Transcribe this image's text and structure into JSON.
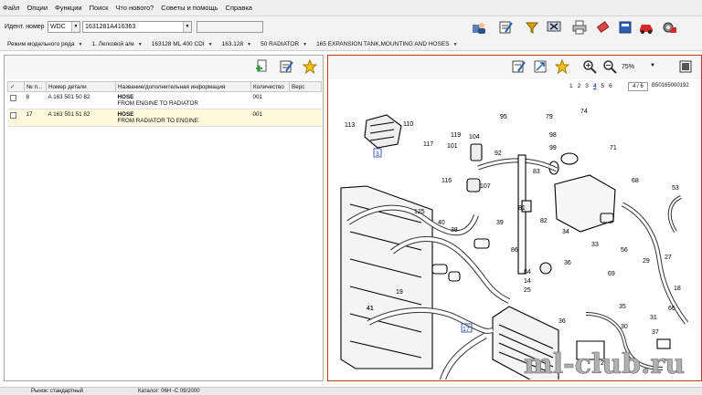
{
  "menu": [
    "Файл",
    "Опции",
    "Функции",
    "Поиск",
    "Что нового?",
    "Советы и помощь",
    "Справка"
  ],
  "ident": {
    "label": "Идент. номер",
    "type_value": "WDC",
    "vin_value": "1631281A416363",
    "extra_value": ""
  },
  "toolbar_icons": [
    "person-icon",
    "notepad-icon",
    "filter-icon",
    "screen-icon",
    "printer-icon",
    "eraser-icon",
    "book-icon",
    "car-icon",
    "gear-car-icon"
  ],
  "breadcrumb": [
    "Режим модельного ряда",
    "1. Легковой а/м",
    "163128 ML 400 CDI",
    "163.128",
    "50 RADIATOR",
    "165 EXPANSION TANK,MOUNTING AND HOSES"
  ],
  "parts_table": {
    "headers": [
      "✓",
      "№ п...",
      "Номер детали",
      "Название/дополнительная информация",
      "Количество",
      "Верс"
    ],
    "rows": [
      {
        "pos": "8",
        "part": "A 163 501 50 82",
        "name": "HOSE",
        "info": "FROM ENGINE TO RADIATOR",
        "qty": "001",
        "ver": ""
      },
      {
        "pos": "17",
        "part": "A 163 501 51 82",
        "name": "HOSE",
        "info": "FROM RADIATOR TO ENGINE",
        "qty": "001",
        "ver": ""
      }
    ]
  },
  "viewer": {
    "zoom": "75%",
    "pages": [
      "1",
      "2",
      "3",
      "4",
      "5",
      "6"
    ],
    "current_page": "4",
    "page_count": "4 / 6",
    "sheet_id": "B50165000192"
  },
  "diagram_labels": [
    "113",
    "110",
    "117",
    "119",
    "101",
    "95",
    "79",
    "74",
    "98",
    "99",
    "104",
    "92",
    "83",
    "71",
    "116",
    "3",
    "107",
    "125",
    "40",
    "38",
    "39",
    "81",
    "82",
    "34",
    "68",
    "53",
    "41",
    "86",
    "33",
    "56",
    "29",
    "27",
    "36",
    "84",
    "14",
    "25",
    "69",
    "19",
    "41",
    "17",
    "35",
    "31",
    "30",
    "37",
    "36",
    "21",
    "18",
    "66"
  ],
  "status": {
    "market": "Рынок: стандартный",
    "catalog": "Каталог: 06H -C 09/2000"
  },
  "watermark": "ml-club.ru",
  "colors": {
    "accent": "#c0392b",
    "selection": "#fff9dd",
    "link": "#1e40af"
  }
}
